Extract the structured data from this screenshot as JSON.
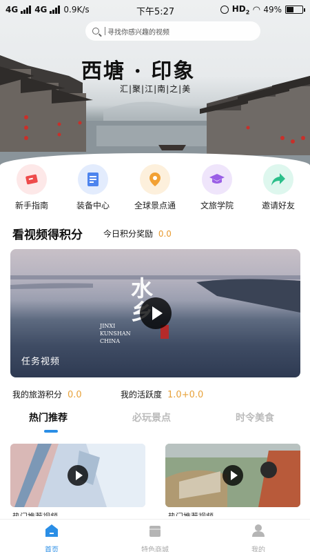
{
  "status_bar": {
    "network_1": "4G",
    "network_2": "4G",
    "speed": "0.9K/s",
    "time": "下午5:27",
    "hd": "HD",
    "hd_sub": "2",
    "battery": "49%",
    "battery_level": 0.49
  },
  "search": {
    "placeholder": "寻找你感兴趣的视频"
  },
  "hero": {
    "title": "西塘 · 印象",
    "subtitle": "汇|聚|江|南|之|美"
  },
  "menu": {
    "items": [
      {
        "label": "新手指南",
        "icon": "guide-icon",
        "bg": "#fde8e8",
        "color": "#ee4b4b"
      },
      {
        "label": "装备中心",
        "icon": "document-icon",
        "bg": "#e3ecfd",
        "color": "#4d84ee"
      },
      {
        "label": "全球景点通",
        "icon": "location-pin-icon",
        "bg": "#fdf0dc",
        "color": "#f2a134"
      },
      {
        "label": "文旅学院",
        "icon": "graduation-cap-icon",
        "bg": "#efe5fb",
        "color": "#9a5fe6"
      },
      {
        "label": "邀请好友",
        "icon": "share-arrow-icon",
        "bg": "#def7ee",
        "color": "#2bbf8a"
      }
    ]
  },
  "points_section": {
    "title": "看视频得积分",
    "daily_label": "今日积分奖励",
    "daily_value": "0.0"
  },
  "video": {
    "calligraphy": "水乡",
    "english": [
      "JINXI",
      "KUNSHAN",
      "CHINA"
    ],
    "tag": "任务视频"
  },
  "stats": {
    "travel_points_label": "我的旅游积分",
    "travel_points_value": "0.0",
    "activity_label": "我的活跃度",
    "activity_value": "1.0+0.0"
  },
  "tabs": [
    {
      "label": "热门推荐",
      "active": true
    },
    {
      "label": "必玩景点",
      "active": false
    },
    {
      "label": "时令美食",
      "active": false
    }
  ],
  "thumbnails": [
    {
      "caption": "热门推荐视频"
    },
    {
      "caption": "热门推荐视频"
    }
  ],
  "bottom_nav": [
    {
      "label": "首页",
      "icon": "home-icon",
      "active": true
    },
    {
      "label": "特色商城",
      "icon": "shop-icon",
      "active": false
    },
    {
      "label": "我的",
      "icon": "user-icon",
      "active": false
    }
  ],
  "colors": {
    "accent": "#2a8ee6",
    "points": "#e8a23a"
  }
}
